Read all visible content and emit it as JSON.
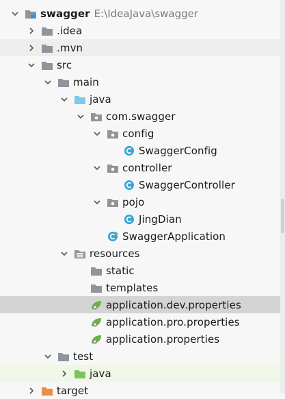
{
  "project_tree": {
    "root": {
      "label": "swagger",
      "path": "E:\\IdeaJava\\swagger"
    },
    "items": [
      {
        "label": ".idea",
        "icon": "folder-icon",
        "arrow": "right"
      },
      {
        "label": ".mvn",
        "icon": "folder-icon",
        "arrow": "right"
      },
      {
        "label": "src",
        "icon": "folder-icon",
        "arrow": "down"
      },
      {
        "label": "main",
        "icon": "folder-icon",
        "arrow": "down"
      },
      {
        "label": "java",
        "icon": "source-folder-icon",
        "arrow": "down"
      },
      {
        "label": "com.swagger",
        "icon": "package-icon",
        "arrow": "down"
      },
      {
        "label": "config",
        "icon": "package-icon",
        "arrow": "down"
      },
      {
        "label": "SwaggerConfig",
        "icon": "class-icon",
        "arrow": "none"
      },
      {
        "label": "controller",
        "icon": "package-icon",
        "arrow": "down"
      },
      {
        "label": "SwaggerController",
        "icon": "class-icon",
        "arrow": "none"
      },
      {
        "label": "pojo",
        "icon": "package-icon",
        "arrow": "down"
      },
      {
        "label": "JingDian",
        "icon": "class-icon",
        "arrow": "none"
      },
      {
        "label": "SwaggerApplication",
        "icon": "spring-boot-class-icon",
        "arrow": "none"
      },
      {
        "label": "resources",
        "icon": "resources-folder-icon",
        "arrow": "down"
      },
      {
        "label": "static",
        "icon": "folder-icon",
        "arrow": "none"
      },
      {
        "label": "templates",
        "icon": "folder-icon",
        "arrow": "none"
      },
      {
        "label": "application.dev.properties",
        "icon": "spring-properties-icon",
        "arrow": "none"
      },
      {
        "label": "application.pro.properties",
        "icon": "spring-properties-icon",
        "arrow": "none"
      },
      {
        "label": "application.properties",
        "icon": "spring-properties-icon",
        "arrow": "none"
      },
      {
        "label": "test",
        "icon": "folder-icon",
        "arrow": "down"
      },
      {
        "label": "java",
        "icon": "test-source-folder-icon",
        "arrow": "right"
      },
      {
        "label": "target",
        "icon": "excluded-folder-icon",
        "arrow": "right"
      }
    ]
  },
  "colors": {
    "folder": "#8e959c",
    "source_folder": "#7ec8ea",
    "test_folder": "#7cc45a",
    "excluded_folder": "#e8904a",
    "class_icon": "#3aa6d8",
    "spring": "#6db33f",
    "selected_row": "#d4d4d4"
  }
}
